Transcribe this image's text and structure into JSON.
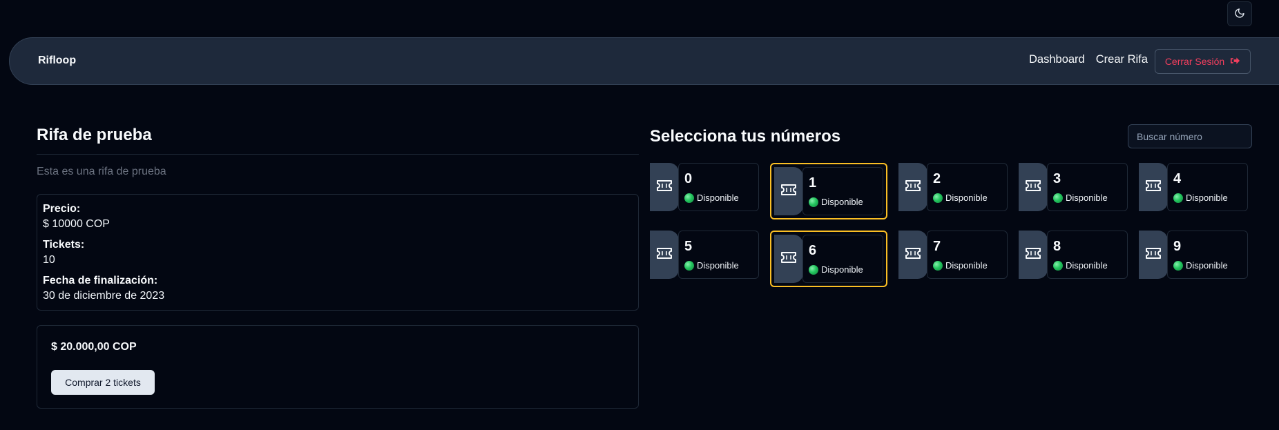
{
  "theme_toggle": {
    "icon": "moon-icon"
  },
  "navbar": {
    "brand": "Rifloop",
    "links": {
      "dashboard": "Dashboard",
      "create": "Crear Rifa"
    },
    "logout": {
      "label": "Cerrar Sesión",
      "icon": "logout-icon",
      "color": "#f43f5e"
    }
  },
  "raffle": {
    "title": "Rifa de prueba",
    "description": "Esta es una rifa de prueba",
    "price_label": "Precio:",
    "price_value": "$ 10000 COP",
    "tickets_label": "Tickets:",
    "tickets_value": "10",
    "end_label": "Fecha de finalización:",
    "end_value": "30 de diciembre de 2023"
  },
  "purchase": {
    "total": "$ 20.000,00 COP",
    "button": "Comprar 2 tickets"
  },
  "numbers_section": {
    "title": "Selecciona tus números",
    "search_placeholder": "Buscar número",
    "selected_color": "#fbbf24",
    "tickets": [
      {
        "number": "0",
        "status": "Disponible",
        "selected": false
      },
      {
        "number": "1",
        "status": "Disponible",
        "selected": true
      },
      {
        "number": "2",
        "status": "Disponible",
        "selected": false
      },
      {
        "number": "3",
        "status": "Disponible",
        "selected": false
      },
      {
        "number": "4",
        "status": "Disponible",
        "selected": false
      },
      {
        "number": "5",
        "status": "Disponible",
        "selected": false
      },
      {
        "number": "6",
        "status": "Disponible",
        "selected": true
      },
      {
        "number": "7",
        "status": "Disponible",
        "selected": false
      },
      {
        "number": "8",
        "status": "Disponible",
        "selected": false
      },
      {
        "number": "9",
        "status": "Disponible",
        "selected": false
      }
    ]
  }
}
